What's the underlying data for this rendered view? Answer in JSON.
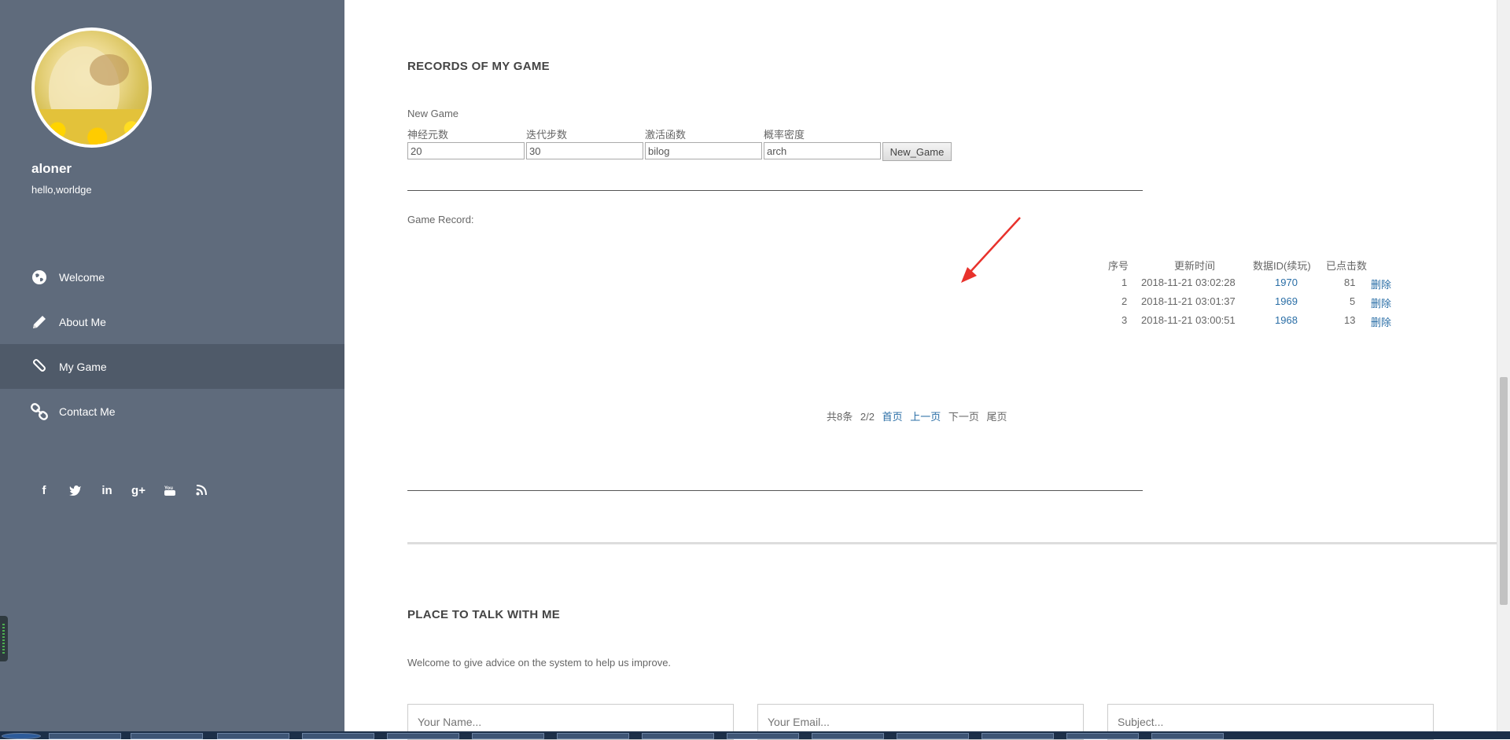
{
  "sidebar": {
    "username": "aloner",
    "tagline": "hello,worldge",
    "nav": [
      {
        "label": "Welcome",
        "icon": "globe-icon"
      },
      {
        "label": "About Me",
        "icon": "pencil-icon"
      },
      {
        "label": "My Game",
        "icon": "paperclip-icon",
        "active": true
      },
      {
        "label": "Contact Me",
        "icon": "link-icon"
      }
    ],
    "social": [
      {
        "icon": "facebook-icon",
        "glyph": "f"
      },
      {
        "icon": "twitter-icon",
        "glyph": "t"
      },
      {
        "icon": "linkedin-icon",
        "glyph": "in"
      },
      {
        "icon": "googleplus-icon",
        "glyph": "g+"
      },
      {
        "icon": "youtube-icon",
        "glyph": "▶"
      },
      {
        "icon": "rss-icon",
        "glyph": "◔"
      }
    ]
  },
  "records": {
    "title": "RECORDS OF MY GAME",
    "new_game_label": "New Game",
    "params": [
      {
        "label": "神经元数",
        "value": "20"
      },
      {
        "label": "迭代步数",
        "value": "30"
      },
      {
        "label": "激活函数",
        "value": "bilog"
      },
      {
        "label": "概率密度",
        "value": "arch"
      }
    ],
    "new_game_button": "New_Game",
    "game_record_label": "Game Record:",
    "table": {
      "headers": [
        "序号",
        "更新时间",
        "数据ID(续玩)",
        "已点击数"
      ],
      "rows": [
        {
          "index": "1",
          "time": "2018-11-21 03:02:28",
          "id": "1970",
          "clicks": "81",
          "action": "删除"
        },
        {
          "index": "2",
          "time": "2018-11-21 03:01:37",
          "id": "1969",
          "clicks": "5",
          "action": "删除"
        },
        {
          "index": "3",
          "time": "2018-11-21 03:00:51",
          "id": "1968",
          "clicks": "13",
          "action": "删除"
        }
      ]
    },
    "pagination": {
      "total": "共8条",
      "page": "2/2",
      "first": "首页",
      "prev": "上一页",
      "next": "下一页",
      "last": "尾页"
    }
  },
  "talk": {
    "title": "PLACE TO TALK WITH ME",
    "description": "Welcome to give advice on the system to help us improve.",
    "name_placeholder": "Your Name...",
    "email_placeholder": "Your Email...",
    "subject_placeholder": "Subject..."
  },
  "colors": {
    "sidebar_bg": "#5f6b7c",
    "sidebar_active": "#4f5a69",
    "link": "#2a6ea6",
    "annotation_arrow": "#e8322c"
  }
}
